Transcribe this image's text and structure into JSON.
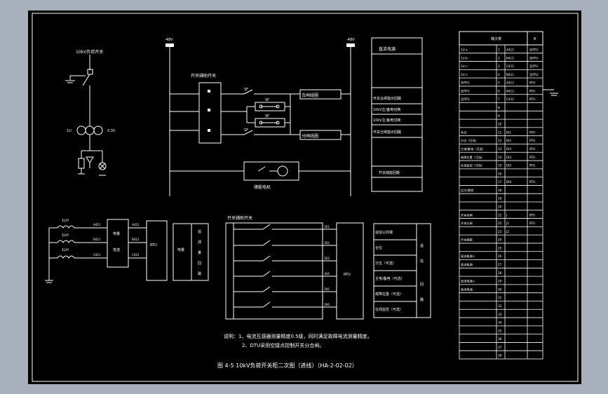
{
  "colors": {
    "paper": "#000000",
    "ink": "#ffffff",
    "surround": "#a9b0bd"
  },
  "top_left": {
    "switch_label": "10kV负荷开关",
    "ct_label": "1U",
    "meter_label": "0.35"
  },
  "control": {
    "bus_left": "-48V",
    "bus_right": "-48V",
    "aux_switch_label": "开关辅助开关",
    "contact_1": "SF",
    "contact_2": "SF",
    "contact_3": "SF",
    "contact_4": "SF",
    "open_coil": "分闸线圈",
    "close_coil": "合闸线圈",
    "motor_label": "储能电机"
  },
  "function_box": {
    "items": [
      "直流电源",
      "开关合闸指示回路",
      "10kV主/备电切换",
      "10kV主/备电切换",
      "开关分闸指示回路",
      "开关储能回路"
    ]
  },
  "bottom_left": {
    "ct_labels": [
      "1LH",
      "1LH",
      "1LH"
    ],
    "wire_labels": [
      "A411",
      "B411",
      "C411"
    ],
    "transmitter_label_1": "电量",
    "transmitter_label_2": "变送",
    "out_labels": [
      "A412",
      "B412",
      "C412"
    ],
    "rtu_label": "RTU",
    "box_label": "电量",
    "side_labels": [
      "遥",
      "测",
      "量",
      "回",
      "路"
    ]
  },
  "bottom_mid": {
    "title": "开关辅助开关",
    "terminals": [
      "DI1",
      "DI2",
      "DI3",
      "DI4",
      "DI5",
      "DI6"
    ],
    "rtu_label": "RTU"
  },
  "signal_box": {
    "rows": [
      "遥信公共端",
      "合位",
      "分位（可选）",
      "主电/备电（可选）",
      "故障位置（可选）",
      "在线监控（可选）"
    ],
    "side_labels": [
      "遥",
      "信",
      "回",
      "路"
    ]
  },
  "notes": {
    "line1": "说明：1、电流互感器测量精度0.5级，同时满足故障电流测量精度。",
    "line2": "2、DTU采用空接点控制开关分合闸。",
    "caption": "图 4-5 10kV负荷开关柜二次图（进线）（HA-2-02-02）"
  },
  "terminal_block": {
    "header": "端子排",
    "rows": [
      {
        "no": "1",
        "l": "1U a",
        "r": "A411",
        "x": "至RTU"
      },
      {
        "no": "2",
        "l": "1U b",
        "r": "B411",
        "x": "至RTU"
      },
      {
        "no": "3",
        "l": "1U c",
        "r": "C411",
        "x": "至RTU"
      },
      {
        "no": "4",
        "l": "1U n",
        "r": "N411",
        "x": "至RTU"
      },
      {
        "no": "5",
        "l": "至RTU",
        "r": "A412",
        "x": "RTU"
      },
      {
        "no": "6",
        "l": "至RTU",
        "r": "B412",
        "x": "RTU"
      },
      {
        "no": "7",
        "l": "至RTU",
        "r": "C412",
        "x": "RTU"
      },
      {
        "no": "8",
        "l": "",
        "r": "",
        "x": ""
      },
      {
        "no": "9",
        "l": "",
        "r": "",
        "x": ""
      },
      {
        "no": "10",
        "l": "",
        "r": "",
        "x": ""
      },
      {
        "no": "11",
        "l": "合位",
        "r": "DI1",
        "x": "RTU"
      },
      {
        "no": "12",
        "l": "分位（可选）",
        "r": "DI2",
        "x": "RTU"
      },
      {
        "no": "13",
        "l": "主电/备电（可选）",
        "r": "DI3",
        "x": "RTU"
      },
      {
        "no": "14",
        "l": "故障位置（可选）",
        "r": "DI4",
        "x": "RTU"
      },
      {
        "no": "15",
        "l": "在线监控（可选）",
        "r": "DI5",
        "x": "RTU"
      },
      {
        "no": "16",
        "l": "",
        "r": "",
        "x": ""
      },
      {
        "no": "17",
        "l": "",
        "r": "DI6",
        "x": "RTU"
      },
      {
        "no": "18",
        "l": "远方/就地",
        "r": "",
        "x": ""
      },
      {
        "no": "19",
        "l": "",
        "r": "",
        "x": ""
      },
      {
        "no": "20",
        "l": "",
        "r": "",
        "x": ""
      },
      {
        "no": "21",
        "l": "开关合闸",
        "r": "J",
        "x": "RTU"
      },
      {
        "no": "22",
        "l": "开关分闸",
        "r": "J1",
        "x": "RTU"
      },
      {
        "no": "23",
        "l": "",
        "r": "J2",
        "x": ""
      },
      {
        "no": "24",
        "l": "开关储能",
        "r": "",
        "x": ""
      },
      {
        "no": "25",
        "l": "",
        "r": "",
        "x": ""
      },
      {
        "no": "26",
        "l": "直流电源+",
        "r": "",
        "x": ""
      },
      {
        "no": "27",
        "l": "直流电源-",
        "r": "",
        "x": ""
      },
      {
        "no": "28",
        "l": "",
        "r": "",
        "x": ""
      },
      {
        "no": "29",
        "l": "直流电源+",
        "r": "",
        "x": ""
      },
      {
        "no": "30",
        "l": "直流电源-",
        "r": "",
        "x": ""
      },
      {
        "no": "31",
        "l": "",
        "r": "",
        "x": ""
      },
      {
        "no": "32",
        "l": "",
        "r": "",
        "x": ""
      },
      {
        "no": "33",
        "l": "",
        "r": "",
        "x": ""
      },
      {
        "no": "34",
        "l": "",
        "r": "",
        "x": ""
      },
      {
        "no": "35",
        "l": "",
        "r": "",
        "x": ""
      },
      {
        "no": "36",
        "l": "",
        "r": "",
        "x": ""
      },
      {
        "no": "37",
        "l": "",
        "r": "",
        "x": ""
      },
      {
        "no": "38",
        "l": "",
        "r": "",
        "x": ""
      }
    ]
  }
}
